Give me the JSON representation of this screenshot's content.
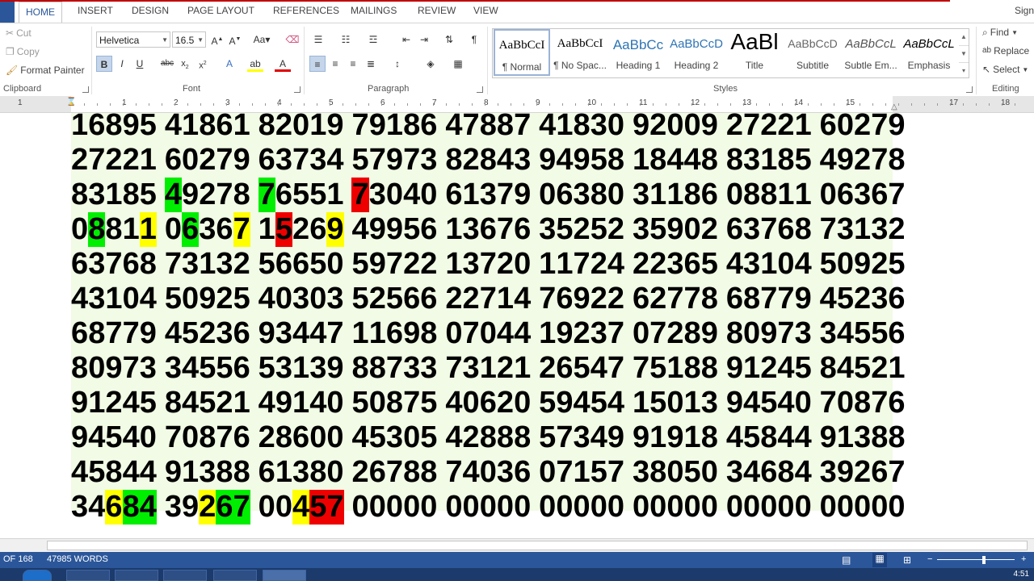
{
  "tabs": [
    {
      "label": "HOME",
      "active": true
    },
    {
      "label": "INSERT"
    },
    {
      "label": "DESIGN"
    },
    {
      "label": "PAGE LAYOUT"
    },
    {
      "label": "REFERENCES"
    },
    {
      "label": "MAILINGS"
    },
    {
      "label": "REVIEW"
    },
    {
      "label": "VIEW"
    }
  ],
  "signin": "Sign",
  "clipboard": {
    "cut": "Cut",
    "copy": "Copy",
    "format_painter": "Format Painter",
    "label": "Clipboard"
  },
  "font": {
    "family": "Helvetica",
    "size": "16.5",
    "label": "Font",
    "case_label": "Aa"
  },
  "paragraph": {
    "label": "Paragraph"
  },
  "styles": {
    "label": "Styles",
    "items": [
      {
        "sample": "AaBbCcI",
        "name": "¶ Normal"
      },
      {
        "sample": "AaBbCcI",
        "name": "¶ No Spac..."
      },
      {
        "sample": "AaBbCc",
        "name": "Heading 1"
      },
      {
        "sample": "AaBbCcD",
        "name": "Heading 2"
      },
      {
        "sample": "AaBl",
        "name": "Title"
      },
      {
        "sample": "AaBbCcD",
        "name": "Subtitle"
      },
      {
        "sample": "AaBbCcL",
        "name": "Subtle Em..."
      },
      {
        "sample": "AaBbCcL",
        "name": "Emphasis"
      }
    ]
  },
  "editing": {
    "find": "Find",
    "replace": "Replace",
    "select": "Select",
    "label": "Editing"
  },
  "ruler": {
    "numbers": [
      "1",
      "1",
      "2",
      "3",
      "4",
      "5",
      "6",
      "7",
      "8",
      "9",
      "10",
      "11",
      "12",
      "13",
      "14",
      "15",
      "17",
      "18"
    ]
  },
  "document": {
    "lines": [
      "16895 41861 82019 79186 47887 41830 92009 27221 60279",
      "27221 60279 63734 57973 82843 94958 18448 83185 49278",
      "83185 49278 76551 73040 61379 06380 31186 08811 06367",
      "08811 06367 15269 49956 13676 35252 35902 63768 73132",
      "63768 73132 56650 59722 13720 11724 22365 43104 50925",
      "43104 50925 40303 52566 22714 76922 62778 68779 45236",
      "68779 45236 93447 11698 07044 19237 07289 80973 34556",
      "80973 34556 53139 88733 73121 26547 75188 91245 84521",
      "91245 84521 49140 50875 40620 59454 15013 94540 70876",
      "94540 70876 28600 45305 42888 57349 91918 45844 91388",
      "45844 91388 61380 26788 74036 07157 38050 34684 39267",
      "34684 39267 00457 00000 00000 00000 00000 00000 00000"
    ],
    "highlights": [
      {
        "line": 2,
        "pos": 6,
        "color": "green"
      },
      {
        "line": 2,
        "pos": 12,
        "color": "green"
      },
      {
        "line": 2,
        "pos": 18,
        "color": "red"
      },
      {
        "line": 3,
        "pos": 1,
        "color": "green"
      },
      {
        "line": 3,
        "pos": 4,
        "color": "yellow"
      },
      {
        "line": 3,
        "pos": 7,
        "color": "green"
      },
      {
        "line": 3,
        "pos": 10,
        "color": "yellow"
      },
      {
        "line": 3,
        "pos": 13,
        "color": "red"
      },
      {
        "line": 3,
        "pos": 16,
        "color": "yellow"
      },
      {
        "line": 11,
        "pos": 2,
        "color": "yellow"
      },
      {
        "line": 11,
        "pos": 3,
        "color": "green"
      },
      {
        "line": 11,
        "pos": 4,
        "color": "green"
      },
      {
        "line": 11,
        "pos": 8,
        "color": "yellow"
      },
      {
        "line": 11,
        "pos": 9,
        "color": "green"
      },
      {
        "line": 11,
        "pos": 10,
        "color": "green"
      },
      {
        "line": 11,
        "pos": 14,
        "color": "yellow"
      },
      {
        "line": 11,
        "pos": 15,
        "color": "red"
      },
      {
        "line": 11,
        "pos": 16,
        "color": "red"
      }
    ]
  },
  "status": {
    "page": "OF 168",
    "words": "47985 WORDS"
  },
  "taskbar": {
    "time": "4:51"
  },
  "colors": {
    "accent": "#2b579a",
    "page_bg": "#f1fbe5",
    "green": "#00ee00",
    "yellow": "#ffff00",
    "red": "#ee0000"
  }
}
